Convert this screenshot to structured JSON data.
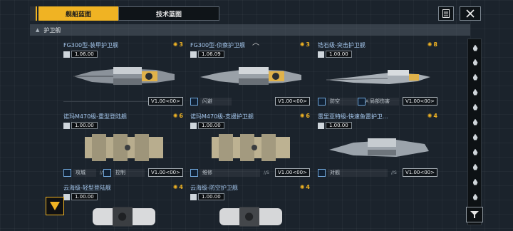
{
  "tabs": [
    {
      "label": "舰船蓝图",
      "active": true
    },
    {
      "label": "技术蓝图",
      "active": false
    }
  ],
  "section": {
    "title": "护卫舰"
  },
  "cards": [
    {
      "name": "FG300型-装甲护卫舰",
      "count": "3",
      "stat": "1.06.00",
      "skills": [],
      "version": "V1.00<00>"
    },
    {
      "name": "FG300型-侦察护卫舰",
      "count": "3",
      "stat": "1.06.09",
      "skills": [
        {
          "label": "闪避",
          "suffix": ""
        }
      ],
      "version": "V1.00<00>"
    },
    {
      "name": "锆石级-突击护卫舰",
      "count": "8",
      "stat": "1.00.00",
      "skills": [
        {
          "label": "防空",
          "suffix": "//A"
        },
        {
          "label": "局部伤害",
          "suffix": ""
        }
      ],
      "version": "V1.00<00>"
    },
    {
      "name": "诺玛M470级-重型登陆舰",
      "count": "6",
      "stat": "1.00.00",
      "skills": [
        {
          "label": "攻城",
          "suffix": "//S"
        },
        {
          "label": "控制",
          "suffix": ""
        }
      ],
      "version": "V1.00<00>"
    },
    {
      "name": "诺玛M470级-支援护卫舰",
      "count": "6",
      "stat": "1.00.00",
      "skills": [
        {
          "label": "维修",
          "suffix": "//S"
        }
      ],
      "version": "V1.00<00>"
    },
    {
      "name": "雷里亚特级-快速鱼雷护卫...",
      "count": "4",
      "stat": "1.00.00",
      "skills": [
        {
          "label": "对舰",
          "suffix": "//S"
        }
      ],
      "version": "V1.00<00>"
    },
    {
      "name": "云海级-轻型登陆舰",
      "count": "4",
      "stat": "1.00.00",
      "skills": [],
      "version": ""
    },
    {
      "name": "云海级-防空护卫舰",
      "count": "4",
      "stat": "1.00.00",
      "skills": [],
      "version": ""
    }
  ],
  "colors": {
    "accent": "#f0b323",
    "name_blue": "#a6c8ee",
    "bg": "#1b232c"
  },
  "icons": {
    "list": "clipboard-list-icon",
    "close": "close-icon",
    "filter": "filter-icon"
  }
}
